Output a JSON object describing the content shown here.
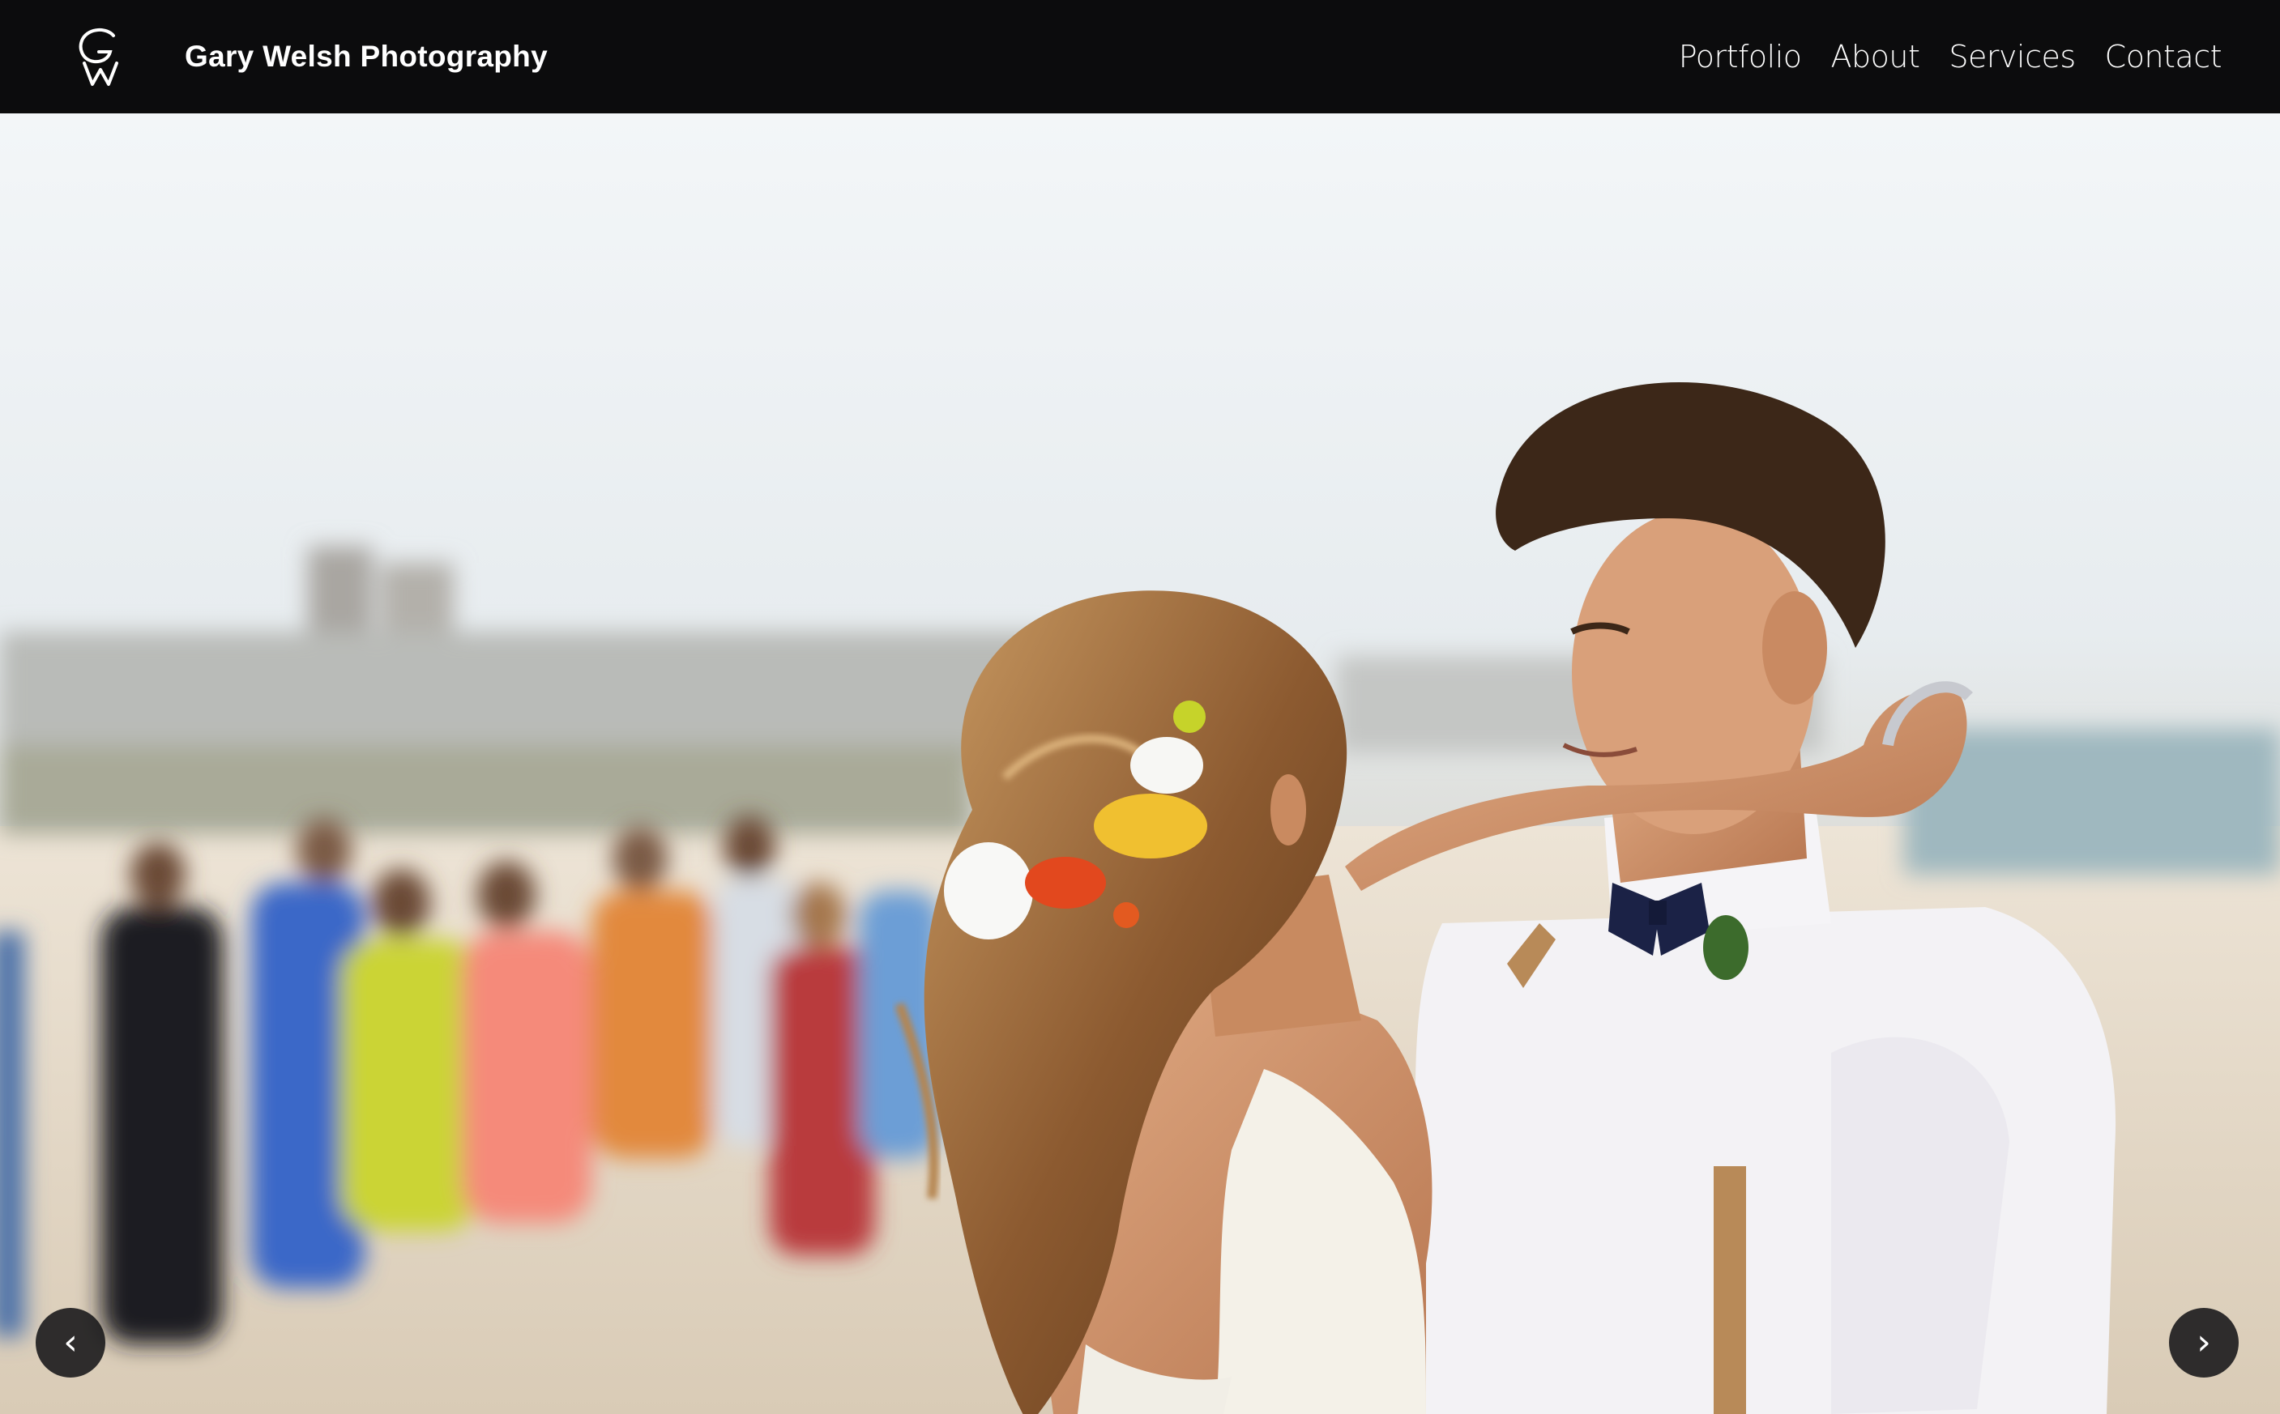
{
  "site": {
    "name": "Gary Welsh Photography",
    "logo_icon": "gw-monogram-icon"
  },
  "nav": {
    "items": [
      {
        "label": "Portfolio"
      },
      {
        "label": "About"
      },
      {
        "label": "Services"
      },
      {
        "label": "Contact"
      }
    ]
  },
  "slider": {
    "prev_label": "‹",
    "next_label": "›",
    "prev_icon": "chevron-left-icon",
    "next_icon": "chevron-right-icon"
  },
  "colors": {
    "header_bg": "#0c0c0d",
    "header_text": "#ffffff",
    "arrow_bg": "#161618"
  }
}
